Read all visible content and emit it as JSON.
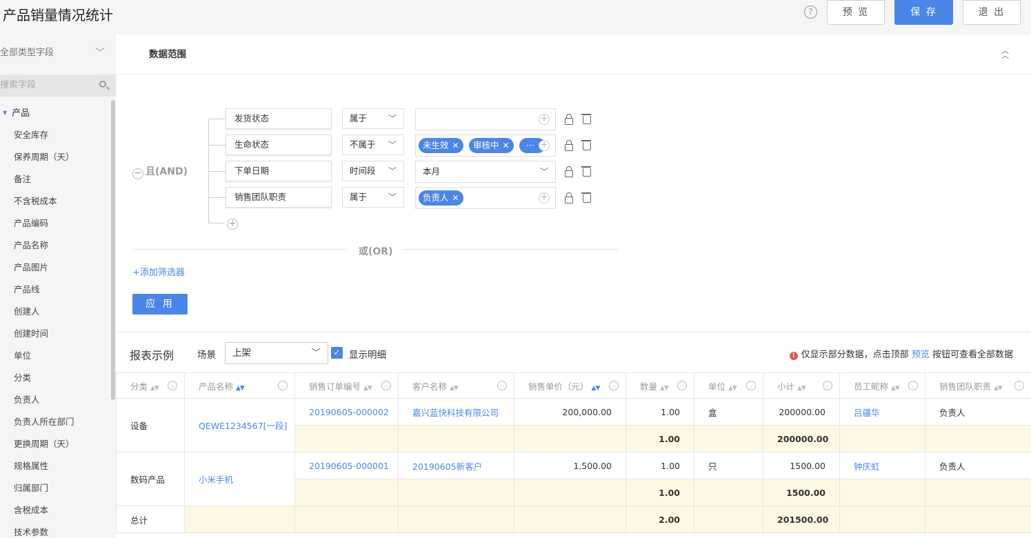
{
  "header": {
    "title": "产品销量情况统计",
    "help_icon": "?",
    "preview_label": "预 览",
    "save_label": "保 存",
    "exit_label": "退 出"
  },
  "sidebar": {
    "type_select": "全部类型字段",
    "search_placeholder": "搜索字段",
    "root": "产品",
    "fields": [
      "安全库存",
      "保养周期（天）",
      "备注",
      "不含税成本",
      "产品编码",
      "产品名称",
      "产品图片",
      "产品线",
      "创建人",
      "创建时间",
      "单位",
      "分类",
      "负责人",
      "负责人所在部门",
      "更换周期（天）",
      "规格属性",
      "归属部门",
      "含税成本",
      "技术参数"
    ]
  },
  "filter": {
    "title": "数据范围",
    "and_label": "且(AND)",
    "or_label": "或(OR)",
    "add_filter": "+添加筛选器",
    "apply": "应 用",
    "conditions": [
      {
        "field": "发货状态",
        "op": "属于",
        "value": ""
      },
      {
        "field": "生命状态",
        "op": "不属于",
        "tags": [
          "未生效",
          "审核中",
          "···"
        ]
      },
      {
        "field": "下单日期",
        "op": "时间段",
        "value": "本月"
      },
      {
        "field": "销售团队职责",
        "op": "属于",
        "tags": [
          "负责人"
        ]
      }
    ]
  },
  "report": {
    "title": "报表示例",
    "scene_label": "场景",
    "scene_value": "上架",
    "show_detail_label": "显示明细",
    "notice_before": "仅显示部分数据，点击顶部",
    "notice_link": "预览",
    "notice_after": "按钮可查看全部数据",
    "columns": [
      "分类",
      "产品名称",
      "销售订单编号",
      "客户名称",
      "销售单价（元）",
      "数量",
      "单位",
      "小计",
      "员工昵称",
      "销售团队职责"
    ],
    "groups": [
      {
        "category": "设备",
        "product": "QEWE1234567[一段]",
        "order": "20190605-000002",
        "customer": "嘉兴蓝快科技有限公司",
        "price": "200,000.00",
        "qty": "1.00",
        "unit": "盒",
        "subtotal": "200000.00",
        "employee": "吕疆华",
        "role": "负责人",
        "sum_qty": "1.00",
        "sum_subtotal": "200000.00"
      },
      {
        "category": "数码产品",
        "product": "小米手机",
        "order": "20190605-000001",
        "customer": "20190605新客户",
        "price": "1,500.00",
        "qty": "1.00",
        "unit": "只",
        "subtotal": "1500.00",
        "employee": "钟庆虹",
        "role": "负责人",
        "sum_qty": "1.00",
        "sum_subtotal": "1500.00"
      }
    ],
    "total_label": "总计",
    "total_qty": "2.00",
    "total_subtotal": "201500.00"
  }
}
